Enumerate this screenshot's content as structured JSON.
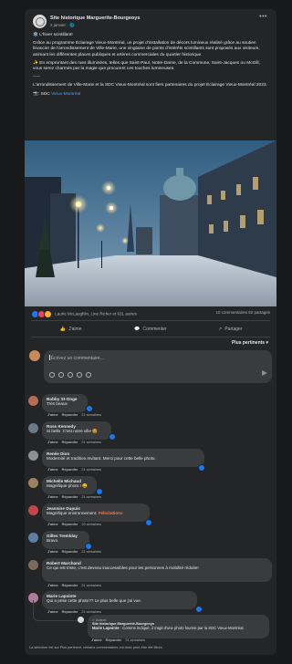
{
  "page": {
    "name": "Site historique Marguerite-Bourgeoys",
    "date": "2 janvier · ",
    "globe_icon": "globe-icon"
  },
  "post": {
    "headline": "❄️ L'hiver scintillant!",
    "p1": "Grâce au programme Éclairage Vieux-Montréal, un projet d'installation de décors lumineux réalisé grâce au soutien financier de l'arrondissement de Ville-Marie, une vingtaine de points d'intérêts scintillants sont proposés aux visiteurs, animant les différentes places publiques et artères commerciales du quartier historique.",
    "p2": "✨ En empruntant des rues illuminées, telles que Saint-Paul, Notre-Dame, de la Commune, Saint-Jacques ou McGill, vous serez charmés par la magie que procurent ces touches lumineuses.",
    "sep": "-----",
    "p3": "L'arrondissement de Ville-Marie et la SDC Vieux-Montréal sont fiers partenaires du projet Éclairage Vieux-Montréal 2023.",
    "credit_prefix": "📸: SDC ",
    "credit_link": "Vieux-Montréal"
  },
  "stats": {
    "reactions": "Laurie McLaughlin, Line Richer et 631 autres",
    "comments_shares": "10 commentaires  62 partages"
  },
  "actions": {
    "like": "J'aime",
    "comment": "Commenter",
    "share": "Partager"
  },
  "sort_label": "Plus pertinents ▾",
  "composer": {
    "placeholder": "Écrivez un commentaire…"
  },
  "comments": [
    {
      "author": "Bobby St-Onge",
      "text": "Très beaux ",
      "like": "J'aime",
      "reply": "Répondre",
      "time": "21 semaines"
    },
    {
      "author": "Ross Kennedy",
      "text": "Si belle. C'est notre ville 🤩",
      "like": "J'aime",
      "reply": "Répondre",
      "time": "21 semaines"
    },
    {
      "author": "Renée Dion",
      "text": "Modernité et tradition.Invitant. Merci pour cette belle photo.",
      "like": "J'aime",
      "reply": "Répondre",
      "time": "21 semaines"
    },
    {
      "author": "Michelle Michaud",
      "text": "Magnifique photo ! 😀",
      "like": "J'aime",
      "reply": "Répondre",
      "time": "21 semaines"
    },
    {
      "author": "Jeannine Dupuis",
      "text": "Magnifique environnement. ",
      "tag": "Félicitations",
      "like": "J'aime",
      "reply": "Répondre",
      "time": "20 semaines"
    },
    {
      "author": "Gilles Tremblay",
      "text": "Bravo.",
      "like": "J'aime",
      "reply": "Répondre",
      "time": "21 semaines"
    },
    {
      "author": "Robert Marchand",
      "text": "Ce qui est triste, c'est devenu inaccessibles pour les personnes à mobilité réduite!",
      "like": "J'aime",
      "reply": "Répondre",
      "time": "21 semaines"
    },
    {
      "author": "Marie Lapointe",
      "text": "Qui a prise cette photo?? Le plus belle que j'ai vue.",
      "like": "J'aime",
      "reply": "Répondre",
      "time": "21 semaines"
    }
  ],
  "reply": {
    "badge": "✓ Auteur",
    "author": "Site historique Marguerite-Bourgeoys",
    "mention": "Marie Lapointe",
    "text": " · Comme indiqué, il s'agit d'une photo fournie par la SDC Vieux-Montréal.",
    "like": "J'aime",
    "reply_label": "Répondre",
    "time": "21 semaines"
  },
  "footer": "La sélection est sur Plus pertinent, certains commentaires ont donc peut-être été filtrés.",
  "colors": {
    "accent": "#1877f2",
    "bg": "#18191a",
    "card": "#242526",
    "bubble": "#3a3b3c",
    "tag": "#ff7a3d"
  }
}
